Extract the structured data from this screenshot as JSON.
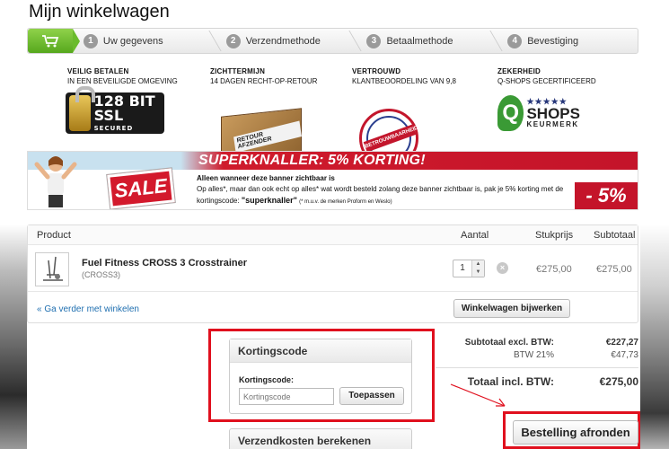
{
  "page": {
    "title": "Mijn winkelwagen"
  },
  "steps": [
    {
      "num": "1",
      "label": "Uw gegevens"
    },
    {
      "num": "2",
      "label": "Verzendmethode"
    },
    {
      "num": "3",
      "label": "Betaalmethode"
    },
    {
      "num": "4",
      "label": "Bevestiging"
    }
  ],
  "usps": [
    {
      "title": "Veilig betalen",
      "subtitle": "In een beveiligde omgeving",
      "badge_big": "128 BIT SSL",
      "badge_small": "SECURED"
    },
    {
      "title": "Zichttermijn",
      "subtitle": "14 dagen recht-op-retour",
      "badge_text": "RETOUR AFZENDER"
    },
    {
      "title": "Vertrouwd",
      "subtitle": "Klantbeoordeling van 9,8",
      "badge_text": "BETROUWBAARHEID"
    },
    {
      "title": "Zekerheid",
      "subtitle": "Q-shops gecertificeerd",
      "badge_name": "SHOPS",
      "badge_q": "Q",
      "badge_sub": "KEURMERK"
    }
  ],
  "banner": {
    "title": "SUPERKNALLER: 5% KORTING!",
    "sale": "SALE",
    "line1": "Alleen wanneer deze banner zichtbaar is",
    "line2": "Op alles*, maar dan ook echt op alles* wat wordt besteld zolang deze banner zichtbaar is, pak je 5% korting met de",
    "line3_prefix": "kortingscode:",
    "code": "\"superknaller\"",
    "note": "(* m.u.v. de merken Proform en Weslo)",
    "percent": "- 5%"
  },
  "cart": {
    "headers": {
      "product": "Product",
      "qty": "Aantal",
      "unit": "Stukprijs",
      "subtotal": "Subtotaal"
    },
    "items": [
      {
        "name": "Fuel Fitness CROSS 3 Crosstrainer",
        "sku": "(CROSS3)",
        "qty": "1",
        "unit_price": "€275,00",
        "subtotal": "€275,00"
      }
    ],
    "continue_link": "« Ga verder met winkelen",
    "update_button": "Winkelwagen bijwerken"
  },
  "coupon": {
    "heading": "Kortingscode",
    "label": "Kortingscode:",
    "placeholder": "Kortingscode",
    "apply_button": "Toepassen"
  },
  "shipping": {
    "heading": "Verzendkosten berekenen"
  },
  "totals": {
    "subtotal_label": "Subtotaal excl. BTW:",
    "subtotal_value": "€227,27",
    "vat_label": "BTW 21%",
    "vat_value": "€47,73",
    "total_label": "Totaal incl. BTW:",
    "total_value": "€275,00"
  },
  "checkout_button": "Bestelling afronden",
  "colors": {
    "highlight_frame": "#e0101e",
    "step_active": "#6abb2c",
    "banner_red": "#c4142a",
    "link": "#1f6fb0"
  }
}
